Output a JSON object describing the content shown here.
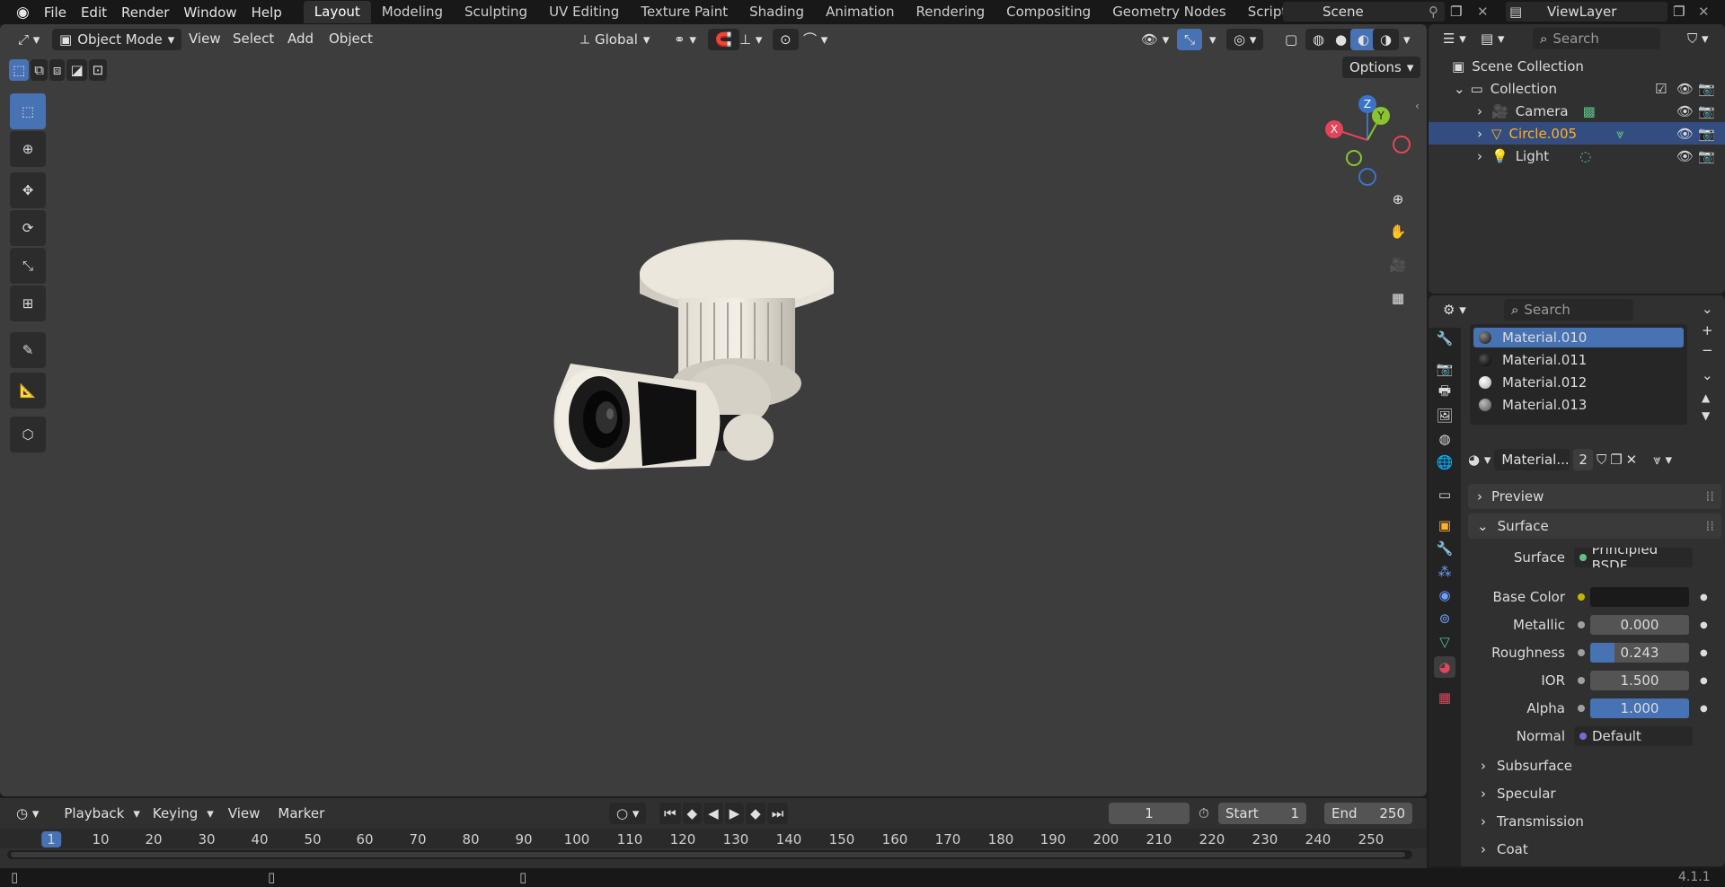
{
  "app": {
    "menu": [
      "File",
      "Edit",
      "Render",
      "Window",
      "Help"
    ],
    "workspaces": [
      "Layout",
      "Modeling",
      "Sculpting",
      "UV Editing",
      "Texture Paint",
      "Shading",
      "Animation",
      "Rendering",
      "Compositing",
      "Geometry Nodes",
      "Scripting"
    ],
    "active_workspace": "Layout",
    "scene": "Scene",
    "view_layer": "ViewLayer",
    "version": "4.1.1"
  },
  "viewport": {
    "mode": "Object Mode",
    "menus": [
      "View",
      "Select",
      "Add",
      "Object"
    ],
    "orientation": "Global",
    "options": "Options",
    "gizmo": {
      "x": "X",
      "y": "Y",
      "z": "Z"
    }
  },
  "outliner": {
    "search_placeholder": "Search",
    "root": "Scene Collection",
    "collection": "Collection",
    "items": [
      {
        "name": "Camera",
        "selected": false
      },
      {
        "name": "Circle.005",
        "selected": true
      },
      {
        "name": "Light",
        "selected": false
      }
    ]
  },
  "properties": {
    "search_placeholder": "Search",
    "materials": [
      "Material.010",
      "Material.011",
      "Material.012",
      "Material.013"
    ],
    "selected_material": "Material.010",
    "slot_name": "Material...",
    "users": "2",
    "panels": {
      "preview": "Preview",
      "surface": "Surface"
    },
    "surface_shader_label": "Surface",
    "surface_shader": "Principled BSDF",
    "fields": [
      {
        "label": "Base Color",
        "value": "",
        "dot": "#c8b400"
      },
      {
        "label": "Metallic",
        "value": "0.000",
        "fill": 0
      },
      {
        "label": "Roughness",
        "value": "0.243",
        "fill": 0.243
      },
      {
        "label": "IOR",
        "value": "1.500",
        "fill": 0
      },
      {
        "label": "Alpha",
        "value": "1.000",
        "fill": 1
      },
      {
        "label": "Normal",
        "value": "Default",
        "dot": "#6f6fd8"
      }
    ],
    "subpanels": [
      "Subsurface",
      "Specular",
      "Transmission",
      "Coat"
    ]
  },
  "timeline": {
    "menus": [
      "Playback",
      "Keying",
      "View",
      "Marker"
    ],
    "current_frame": "1",
    "start_label": "Start",
    "start": "1",
    "end_label": "End",
    "end": "250",
    "ruler": [
      "1",
      "10",
      "20",
      "30",
      "40",
      "50",
      "60",
      "70",
      "80",
      "90",
      "100",
      "110",
      "120",
      "130",
      "140",
      "150",
      "160",
      "170",
      "180",
      "190",
      "200",
      "210",
      "220",
      "230",
      "240",
      "250"
    ]
  },
  "colors": {
    "accent": "#4772b3",
    "select": "#334d80",
    "orange": "#ffaf29"
  }
}
